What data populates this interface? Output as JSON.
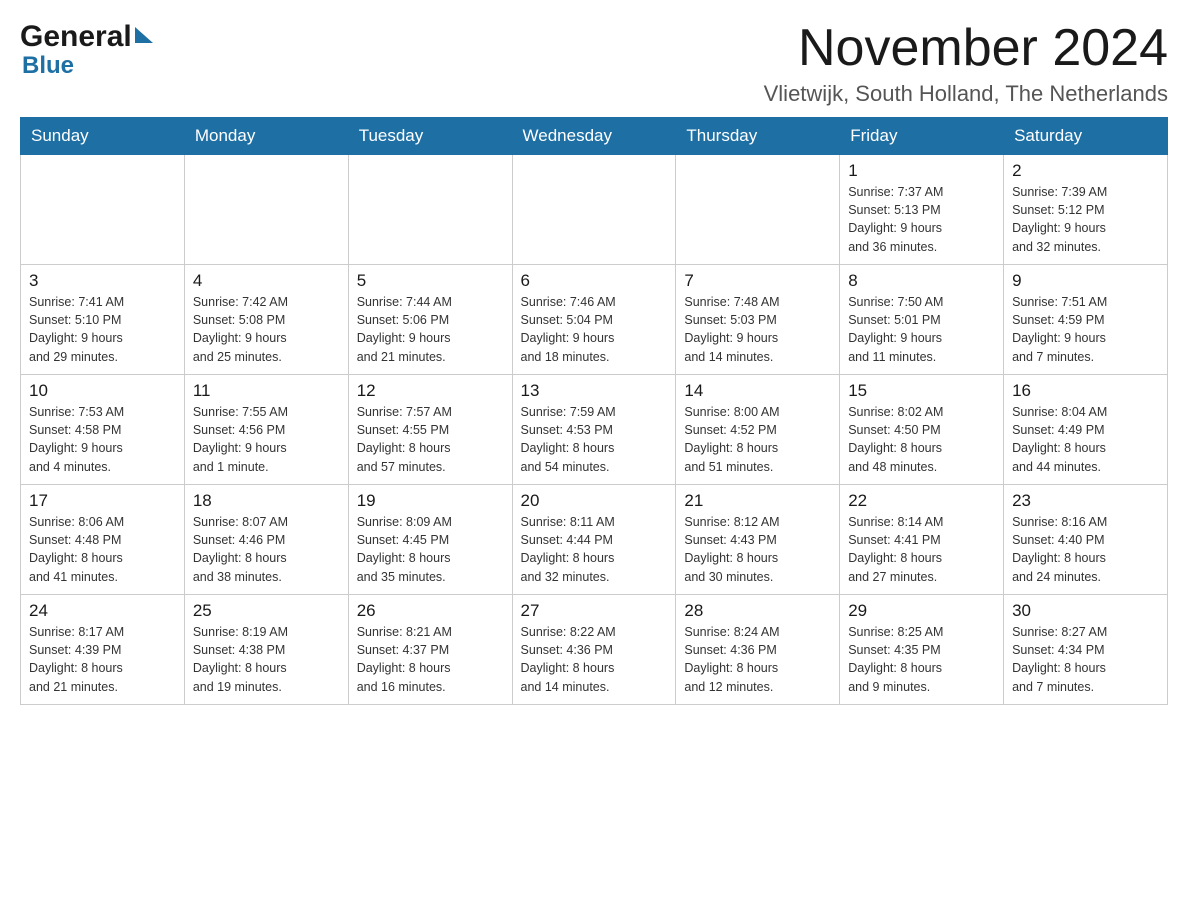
{
  "header": {
    "logo_general": "General",
    "logo_blue": "Blue",
    "month_title": "November 2024",
    "location": "Vlietwijk, South Holland, The Netherlands"
  },
  "weekdays": [
    "Sunday",
    "Monday",
    "Tuesday",
    "Wednesday",
    "Thursday",
    "Friday",
    "Saturday"
  ],
  "weeks": [
    {
      "days": [
        {
          "number": "",
          "info": ""
        },
        {
          "number": "",
          "info": ""
        },
        {
          "number": "",
          "info": ""
        },
        {
          "number": "",
          "info": ""
        },
        {
          "number": "",
          "info": ""
        },
        {
          "number": "1",
          "info": "Sunrise: 7:37 AM\nSunset: 5:13 PM\nDaylight: 9 hours\nand 36 minutes."
        },
        {
          "number": "2",
          "info": "Sunrise: 7:39 AM\nSunset: 5:12 PM\nDaylight: 9 hours\nand 32 minutes."
        }
      ]
    },
    {
      "days": [
        {
          "number": "3",
          "info": "Sunrise: 7:41 AM\nSunset: 5:10 PM\nDaylight: 9 hours\nand 29 minutes."
        },
        {
          "number": "4",
          "info": "Sunrise: 7:42 AM\nSunset: 5:08 PM\nDaylight: 9 hours\nand 25 minutes."
        },
        {
          "number": "5",
          "info": "Sunrise: 7:44 AM\nSunset: 5:06 PM\nDaylight: 9 hours\nand 21 minutes."
        },
        {
          "number": "6",
          "info": "Sunrise: 7:46 AM\nSunset: 5:04 PM\nDaylight: 9 hours\nand 18 minutes."
        },
        {
          "number": "7",
          "info": "Sunrise: 7:48 AM\nSunset: 5:03 PM\nDaylight: 9 hours\nand 14 minutes."
        },
        {
          "number": "8",
          "info": "Sunrise: 7:50 AM\nSunset: 5:01 PM\nDaylight: 9 hours\nand 11 minutes."
        },
        {
          "number": "9",
          "info": "Sunrise: 7:51 AM\nSunset: 4:59 PM\nDaylight: 9 hours\nand 7 minutes."
        }
      ]
    },
    {
      "days": [
        {
          "number": "10",
          "info": "Sunrise: 7:53 AM\nSunset: 4:58 PM\nDaylight: 9 hours\nand 4 minutes."
        },
        {
          "number": "11",
          "info": "Sunrise: 7:55 AM\nSunset: 4:56 PM\nDaylight: 9 hours\nand 1 minute."
        },
        {
          "number": "12",
          "info": "Sunrise: 7:57 AM\nSunset: 4:55 PM\nDaylight: 8 hours\nand 57 minutes."
        },
        {
          "number": "13",
          "info": "Sunrise: 7:59 AM\nSunset: 4:53 PM\nDaylight: 8 hours\nand 54 minutes."
        },
        {
          "number": "14",
          "info": "Sunrise: 8:00 AM\nSunset: 4:52 PM\nDaylight: 8 hours\nand 51 minutes."
        },
        {
          "number": "15",
          "info": "Sunrise: 8:02 AM\nSunset: 4:50 PM\nDaylight: 8 hours\nand 48 minutes."
        },
        {
          "number": "16",
          "info": "Sunrise: 8:04 AM\nSunset: 4:49 PM\nDaylight: 8 hours\nand 44 minutes."
        }
      ]
    },
    {
      "days": [
        {
          "number": "17",
          "info": "Sunrise: 8:06 AM\nSunset: 4:48 PM\nDaylight: 8 hours\nand 41 minutes."
        },
        {
          "number": "18",
          "info": "Sunrise: 8:07 AM\nSunset: 4:46 PM\nDaylight: 8 hours\nand 38 minutes."
        },
        {
          "number": "19",
          "info": "Sunrise: 8:09 AM\nSunset: 4:45 PM\nDaylight: 8 hours\nand 35 minutes."
        },
        {
          "number": "20",
          "info": "Sunrise: 8:11 AM\nSunset: 4:44 PM\nDaylight: 8 hours\nand 32 minutes."
        },
        {
          "number": "21",
          "info": "Sunrise: 8:12 AM\nSunset: 4:43 PM\nDaylight: 8 hours\nand 30 minutes."
        },
        {
          "number": "22",
          "info": "Sunrise: 8:14 AM\nSunset: 4:41 PM\nDaylight: 8 hours\nand 27 minutes."
        },
        {
          "number": "23",
          "info": "Sunrise: 8:16 AM\nSunset: 4:40 PM\nDaylight: 8 hours\nand 24 minutes."
        }
      ]
    },
    {
      "days": [
        {
          "number": "24",
          "info": "Sunrise: 8:17 AM\nSunset: 4:39 PM\nDaylight: 8 hours\nand 21 minutes."
        },
        {
          "number": "25",
          "info": "Sunrise: 8:19 AM\nSunset: 4:38 PM\nDaylight: 8 hours\nand 19 minutes."
        },
        {
          "number": "26",
          "info": "Sunrise: 8:21 AM\nSunset: 4:37 PM\nDaylight: 8 hours\nand 16 minutes."
        },
        {
          "number": "27",
          "info": "Sunrise: 8:22 AM\nSunset: 4:36 PM\nDaylight: 8 hours\nand 14 minutes."
        },
        {
          "number": "28",
          "info": "Sunrise: 8:24 AM\nSunset: 4:36 PM\nDaylight: 8 hours\nand 12 minutes."
        },
        {
          "number": "29",
          "info": "Sunrise: 8:25 AM\nSunset: 4:35 PM\nDaylight: 8 hours\nand 9 minutes."
        },
        {
          "number": "30",
          "info": "Sunrise: 8:27 AM\nSunset: 4:34 PM\nDaylight: 8 hours\nand 7 minutes."
        }
      ]
    }
  ]
}
